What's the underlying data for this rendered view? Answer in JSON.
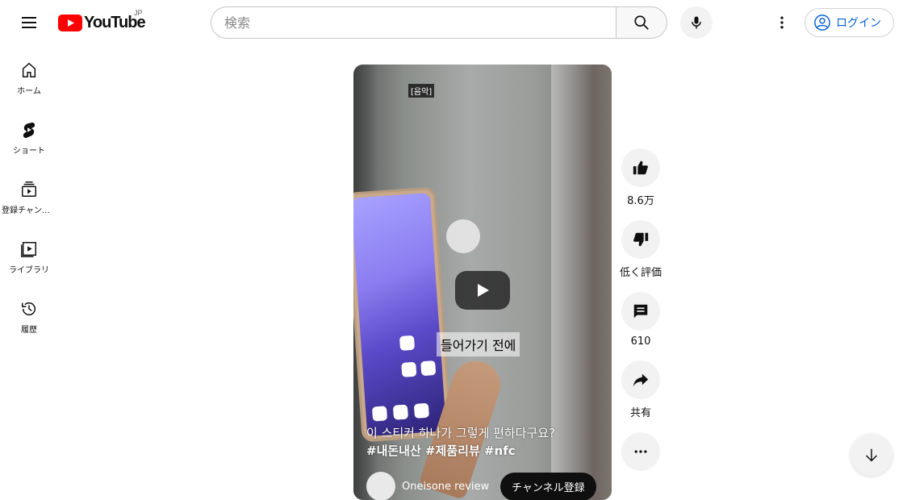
{
  "header": {
    "logo_text": "YouTube",
    "region": "JP",
    "search_placeholder": "検索",
    "login_label": "ログイン"
  },
  "guide": {
    "items": [
      {
        "label": "ホーム",
        "icon": "home-icon"
      },
      {
        "label": "ショート",
        "icon": "shorts-icon"
      },
      {
        "label": "登録チャンネル",
        "icon": "subscriptions-icon"
      },
      {
        "label": "ライブラリ",
        "icon": "library-icon"
      },
      {
        "label": "履歴",
        "icon": "history-icon"
      }
    ]
  },
  "video": {
    "caption_top": "[음악]",
    "caption_mid": "들어가기 전에",
    "title": "이 스티커 하나가 그렇게 편하다구요?",
    "tags": "#내돈내산 #제품리뷰 #nfc",
    "channel_name": "Oneisone review",
    "subscribe_label": "チャンネル登録"
  },
  "actions": {
    "like_count": "8.6万",
    "dislike_label": "低く評価",
    "comment_count": "610",
    "share_label": "共有"
  },
  "colors": {
    "brand_red": "#ff0000",
    "link_blue": "#065fd4"
  }
}
